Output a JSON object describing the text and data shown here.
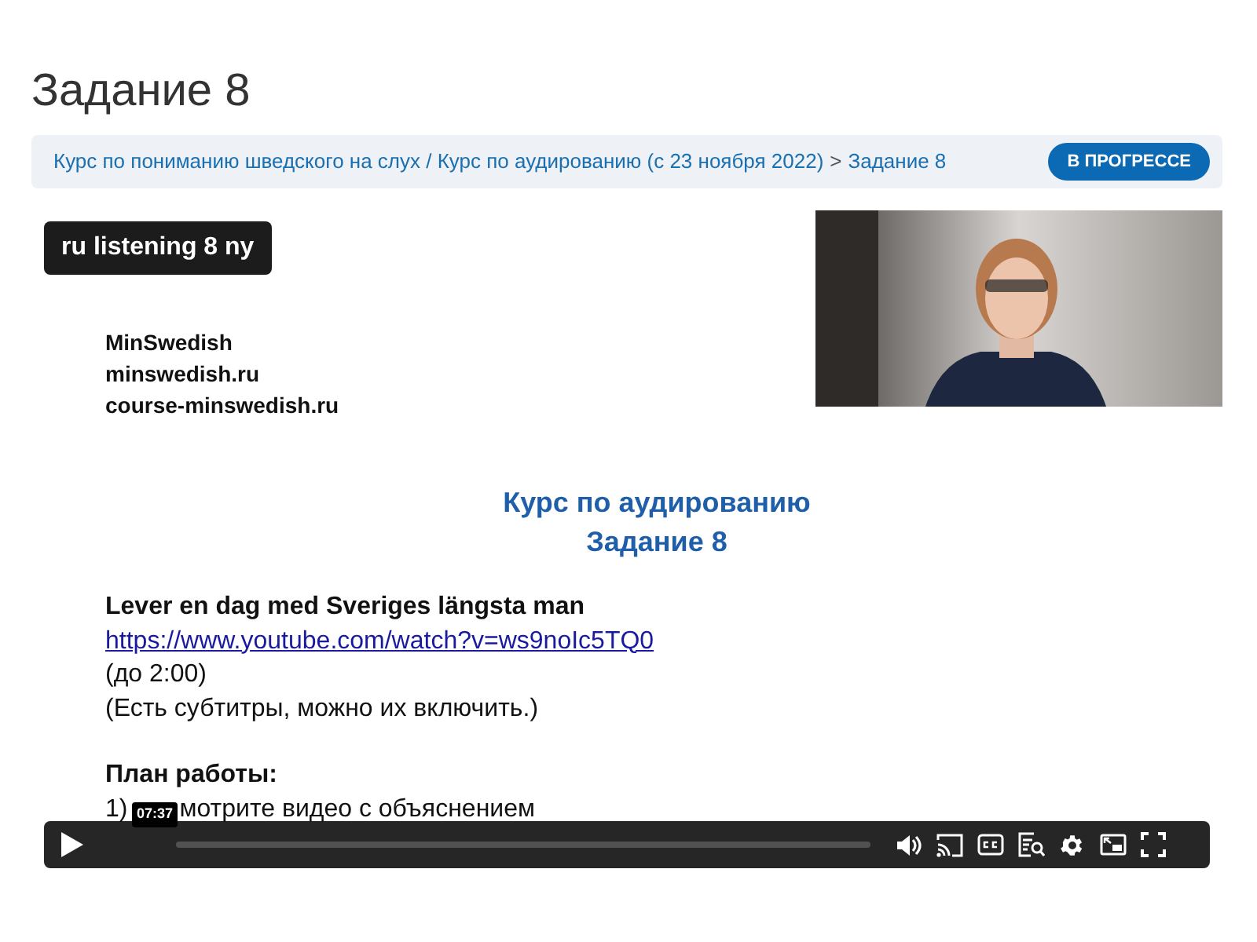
{
  "page_title": "Задание 8",
  "breadcrumb": {
    "path": "Курс по пониманию шведского на слух / Курс по аудированию (с 23 ноября 2022)",
    "separator": ">",
    "current": "Задание 8"
  },
  "status_badge": "В ПРОГРЕССЕ",
  "video": {
    "title": "ru listening 8 ny",
    "slide": {
      "header_lines": [
        "MinSwedish",
        "minswedish.ru",
        "course-minswedish.ru"
      ],
      "heading": [
        "Курс по аудированию",
        "Задание 8"
      ],
      "video_title": "Lever en dag med Sveriges längsta man",
      "link": "https://www.youtube.com/watch?v=ws9noIc5TQ0",
      "notes": [
        "(до 2:00)",
        "(Есть субтитры, можно их включить.)"
      ],
      "plan_title": "План работы:",
      "plan_steps": [
        {
          "number": "1)",
          "text": "мотрите видео с объяснением"
        }
      ]
    },
    "controls": {
      "hover_time": "07:37"
    }
  }
}
